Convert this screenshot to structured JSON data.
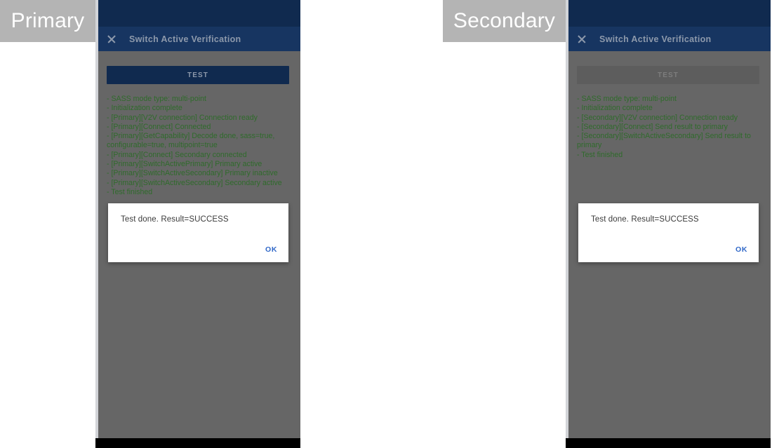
{
  "annotations": {
    "primary": "Primary",
    "secondary": "Secondary"
  },
  "panels": {
    "primary": {
      "app_bar": {
        "close_icon": "close-icon",
        "title": "Switch Active Verification"
      },
      "test_button": {
        "label": "TEST",
        "state": "enabled"
      },
      "log": "- SASS mode type: multi-point\n- Initialization complete\n- [Primary][V2V connection] Connection ready\n- [Primary][Connect] Connected\n- [Primary][GetCapability] Decode done, sass=true, configurable=true, multipoint=true\n- [Primary][Connect] Secondary connected\n- [Primary][SwitchActivePrimary] Primary active\n- [Primary][SwitchActiveSecondary] Primary inactive\n- [Primary][SwitchActiveSecondary] Secondary active\n- Test finished",
      "dialog": {
        "message": "Test done. Result=SUCCESS",
        "ok_label": "OK"
      }
    },
    "secondary": {
      "app_bar": {
        "close_icon": "close-icon",
        "title": "Switch Active Verification"
      },
      "test_button": {
        "label": "TEST",
        "state": "disabled"
      },
      "log": "- SASS mode type: multi-point\n- Initialization complete\n- [Secondary][V2V connection] Connection ready\n- [Secondary][Connect] Send result to primary\n- [Secondary][SwitchActiveSecondary] Send result to primary\n- Test finished",
      "dialog": {
        "message": "Test done. Result=SUCCESS",
        "ok_label": "OK"
      }
    }
  },
  "colors": {
    "status_bar": "#102a4f",
    "app_bar": "#173561",
    "app_bar_text": "#8d99ab",
    "scrim": "#666666",
    "log_text": "#2f6b2b",
    "dialog_bg": "#ffffff",
    "dialog_action": "#2f67c8",
    "annotation_bg": "#b4b4b4",
    "nav_bar": "#000000"
  }
}
